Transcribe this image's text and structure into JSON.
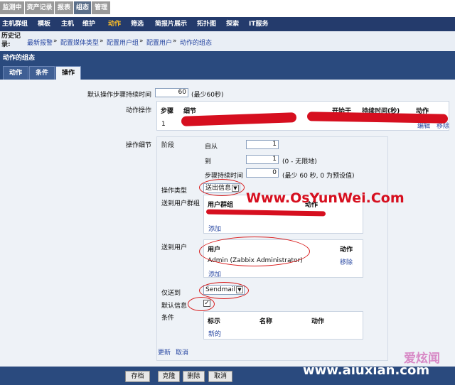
{
  "top_tabs": [
    "监测中",
    "资产记录",
    "报表",
    "组态",
    "管理"
  ],
  "sub_nav": [
    "主机群组",
    "模板",
    "主机",
    "维护",
    "动作",
    "筛选",
    "简报片展示",
    "拓扑图",
    "探索",
    "IT服务"
  ],
  "history": {
    "label": "历史记录:",
    "crumbs": [
      "最新报警",
      "配置媒体类型",
      "配置用户组",
      "配置用户",
      "动作的组态"
    ],
    "separator": "»"
  },
  "section_title": "动作的组态",
  "form_tabs": [
    "动作",
    "条件",
    "操作"
  ],
  "default_step": {
    "label": "默认操作步骤持续时间",
    "value": "60",
    "hint": "(最少60秒)"
  },
  "operations": {
    "label": "动作操作",
    "headers": [
      "步骤",
      "细节",
      "开始于",
      "持续时间(秒)",
      "动作"
    ],
    "row_step": "1",
    "row_actions": [
      "编辑",
      "移除"
    ]
  },
  "details": {
    "label": "操作细节",
    "stage_label": "阶段",
    "from_label": "自从",
    "from_value": "1",
    "to_label": "到",
    "to_value": "1",
    "to_hint": "(0 - 无限地)",
    "duration_label": "步骤持续时间",
    "duration_value": "0",
    "duration_hint": "(最少 60 秒, 0 为预设值)",
    "op_type_label": "操作类型",
    "op_type_value": "送出信息",
    "send_groups_label": "送到用户群组",
    "group_header": "用户群组",
    "group_action_header": "动作",
    "group_add": "添加",
    "send_users_label": "送到用户",
    "user_header": "用户",
    "user_action_header": "动作",
    "user_name": "Admin (Zabbix Administrator)",
    "user_remove": "移除",
    "user_add": "添加",
    "only_send_label": "仅送到",
    "only_send_value": "Sendmail",
    "default_msg_label": "默认信息",
    "default_msg_mark": "✓",
    "conditions_label": "条件",
    "cond_headers": [
      "标示",
      "名称",
      "动作"
    ],
    "cond_new": "新的",
    "update_link": "更新",
    "cancel_link": "取消"
  },
  "footer_buttons": [
    "存档",
    "克隆",
    "删除",
    "取消"
  ],
  "watermark_main": "Www.OsYunWei.Com",
  "watermark_corner_cn": "爱炫闻",
  "watermark_corner_url": "www.aiuxian.com",
  "colors": {
    "nav_blue": "#243b6c",
    "accent_gold": "#f1b72b",
    "link_blue": "#2a49a3",
    "annotation_red": "#d91c1c"
  }
}
